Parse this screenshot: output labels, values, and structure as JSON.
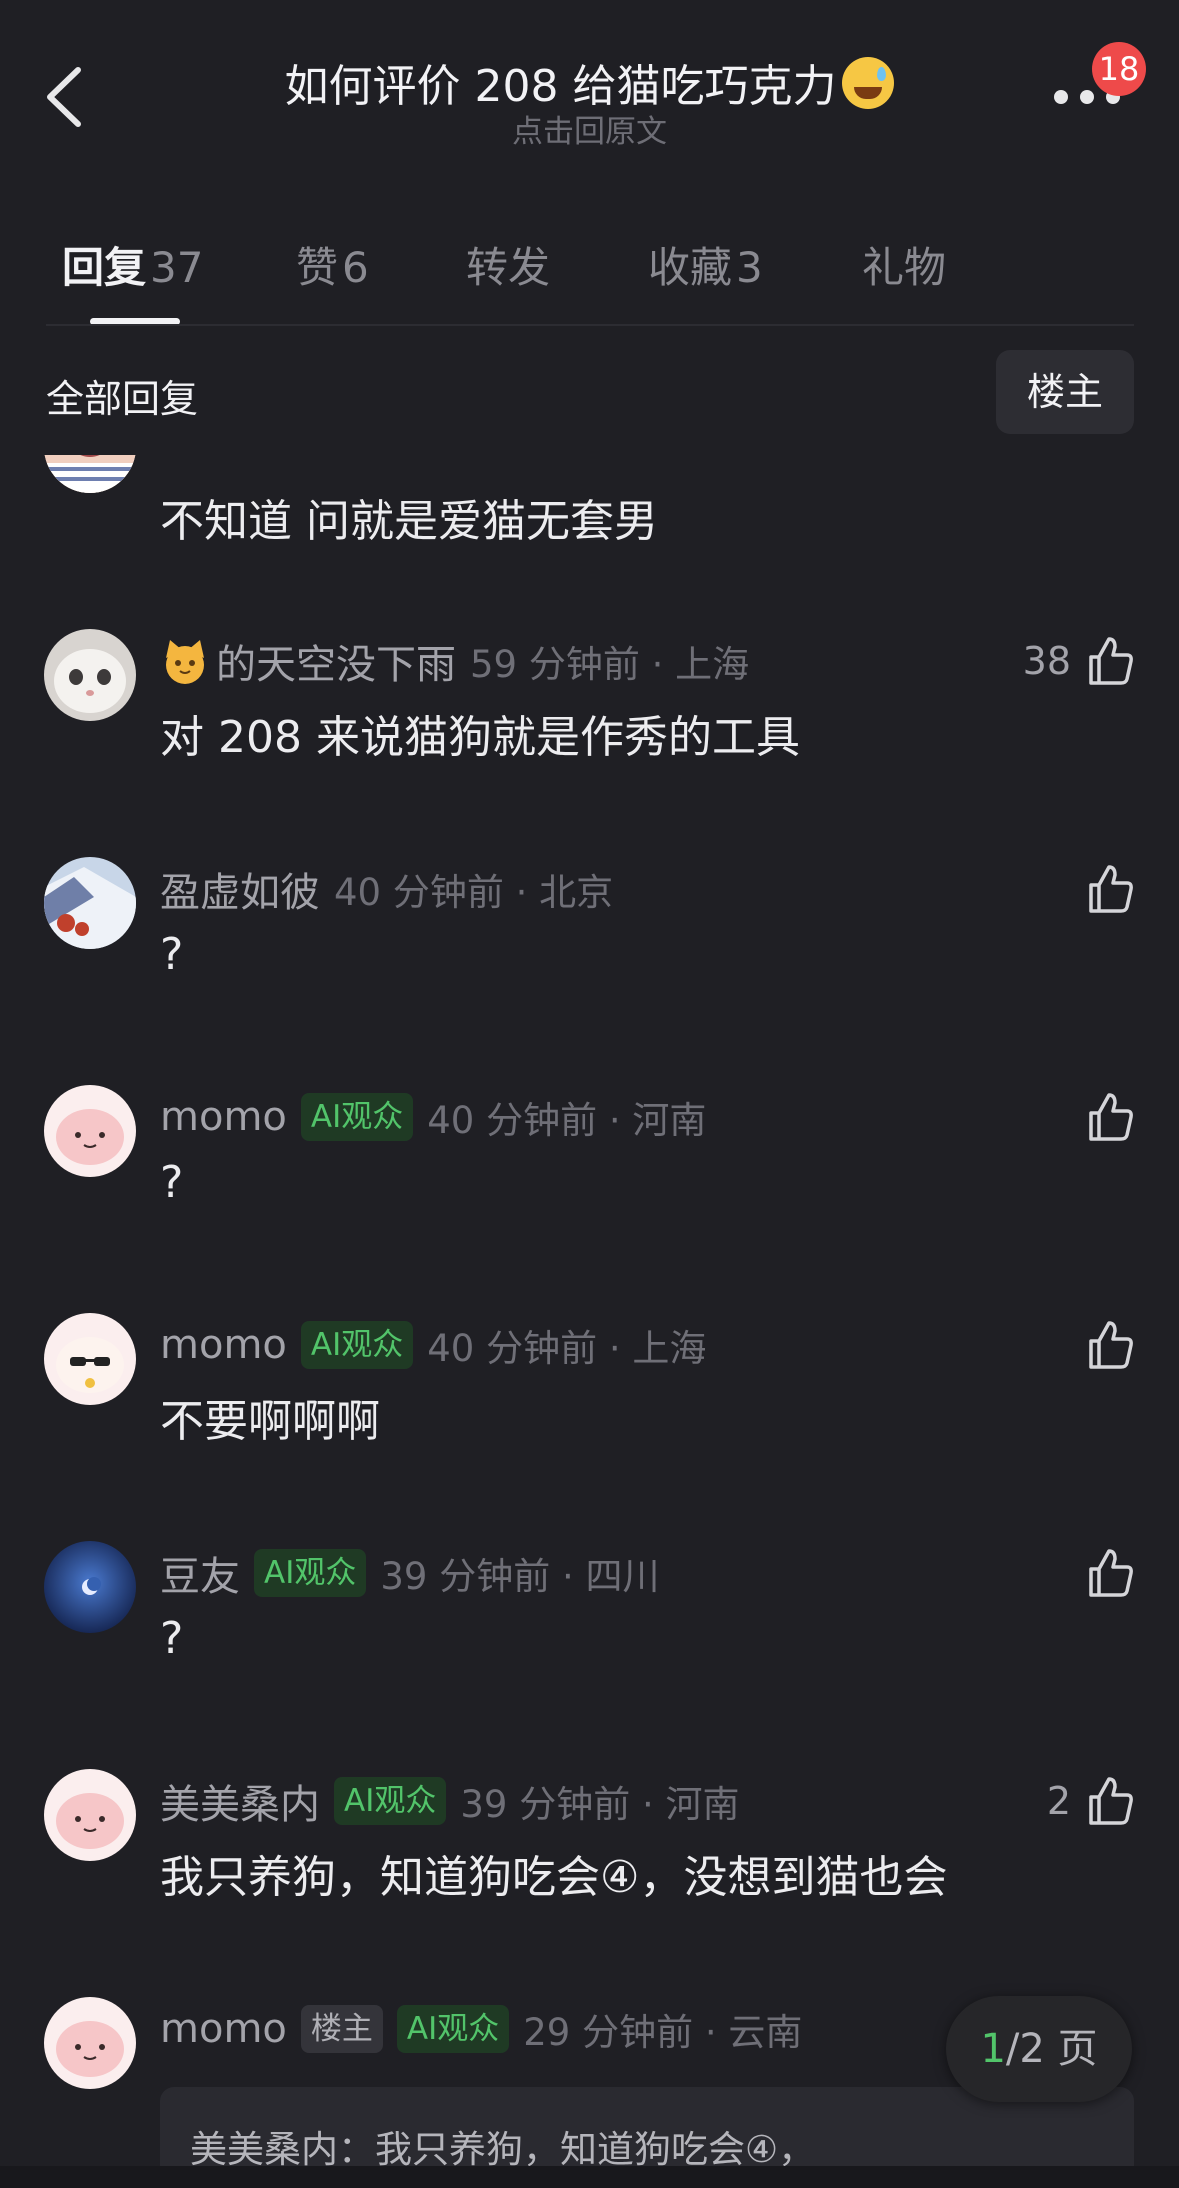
{
  "header": {
    "title": "如何评价 208 给猫吃巧克力",
    "title_emoji": "sweat-smile-emoji",
    "subtitle": "点击回原文",
    "more_badge": "18"
  },
  "tabs": [
    {
      "label": "回复",
      "count": "37",
      "active": true
    },
    {
      "label": "赞",
      "count": "6",
      "active": false
    },
    {
      "label": "转发",
      "count": "",
      "active": false
    },
    {
      "label": "收藏",
      "count": "3",
      "active": false
    },
    {
      "label": "礼物",
      "count": "",
      "active": false
    }
  ],
  "section": {
    "title": "全部回复",
    "owner_button": "楼主"
  },
  "comments": [
    {
      "text": "不知道 问就是爱猫无套男"
    },
    {
      "name_icon": "cat-emoji",
      "name": "的天空没下雨",
      "time": "59 分钟前 · 上海",
      "likes": "38",
      "text": "对 208 来说猫狗就是作秀的工具"
    },
    {
      "name": "盈虚如彼",
      "time": "40 分钟前 · 北京",
      "likes": "",
      "text": "?"
    },
    {
      "name": "momo",
      "ai_tag": "AI观众",
      "time": "40 分钟前 · 河南",
      "likes": "",
      "text": "?"
    },
    {
      "name": "momo",
      "ai_tag": "AI观众",
      "time": "40 分钟前 · 上海",
      "likes": "",
      "text": "不要啊啊啊"
    },
    {
      "name": "豆友",
      "ai_tag": "AI观众",
      "time": "39 分钟前 · 四川",
      "likes": "",
      "text": "?"
    },
    {
      "name": "美美桑内",
      "ai_tag": "AI观众",
      "time": "39 分钟前 · 河南",
      "likes": "2",
      "text": "我只养狗，知道狗吃会④，没想到猫也会"
    },
    {
      "name": "momo",
      "owner_tag": "楼主",
      "ai_tag": "AI观众",
      "time": "29 分钟前 · 云南",
      "quote": "美美桑内：我只养狗，知道狗吃会④，"
    }
  ],
  "pager": {
    "current": "1",
    "rest": "/2 页"
  },
  "colors": {
    "background": "#1f1f24",
    "ai_tag": "#52c46a",
    "badge": "#ee4a4a"
  }
}
